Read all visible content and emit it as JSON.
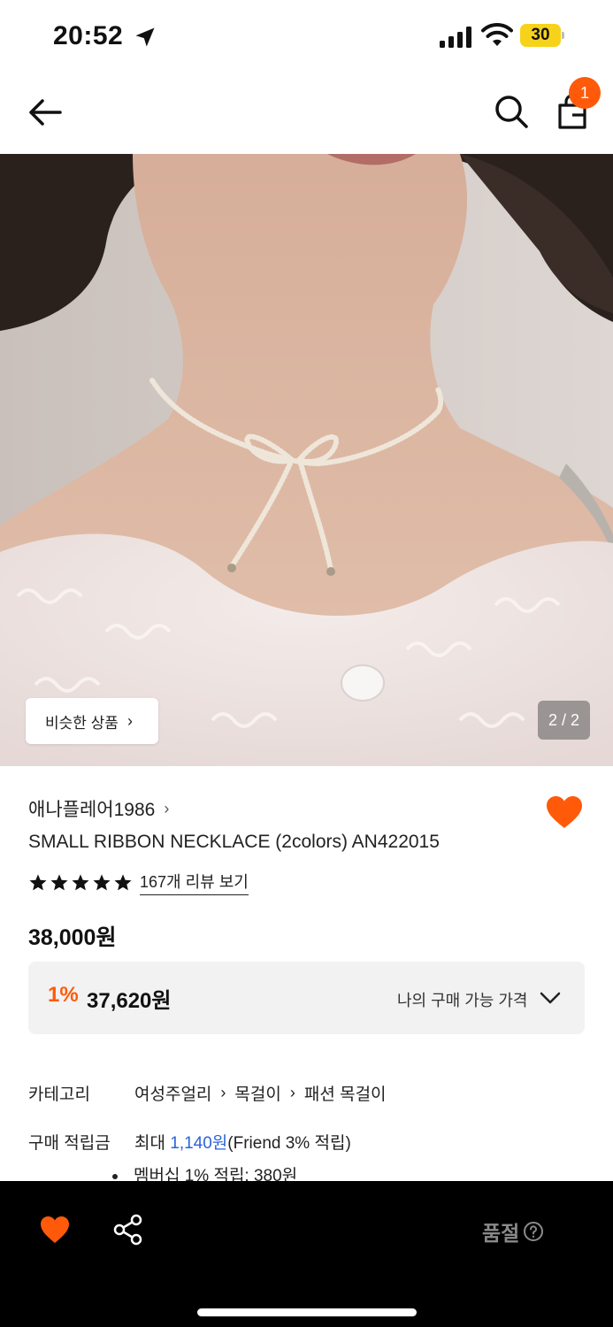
{
  "status_bar": {
    "time": "20:52",
    "battery": "30"
  },
  "nav": {
    "cart_count": "1"
  },
  "gallery": {
    "similar_label": "비슷한 상품",
    "page_indicator": "2 / 2"
  },
  "product": {
    "brand": "애나플레어1986",
    "name": "SMALL RIBBON NECKLACE (2colors) AN422015",
    "rating_stars": 5,
    "review_link": "167개 리뷰 보기",
    "price": "38,000원",
    "discount_rate": "1%",
    "discount_price": "37,620원",
    "my_price_label": "나의 구매 가능 가격"
  },
  "info": {
    "category_label": "카테고리",
    "category_path": [
      "여성주얼리",
      "목걸이",
      "패션 목걸이"
    ],
    "points_label": "구매 적립금",
    "points_prefix": "최대 ",
    "points_amount": "1,140원",
    "points_suffix": "(Friend 3% 적립)",
    "points_detail": "멤버십 1% 적립: 380원"
  },
  "bottom_bar": {
    "status_label": "품절"
  },
  "colors": {
    "accent": "#ff5a0a",
    "link_blue": "#2b63d9",
    "bottom_bg": "#000000",
    "disabled_text": "#8a8a8a"
  }
}
